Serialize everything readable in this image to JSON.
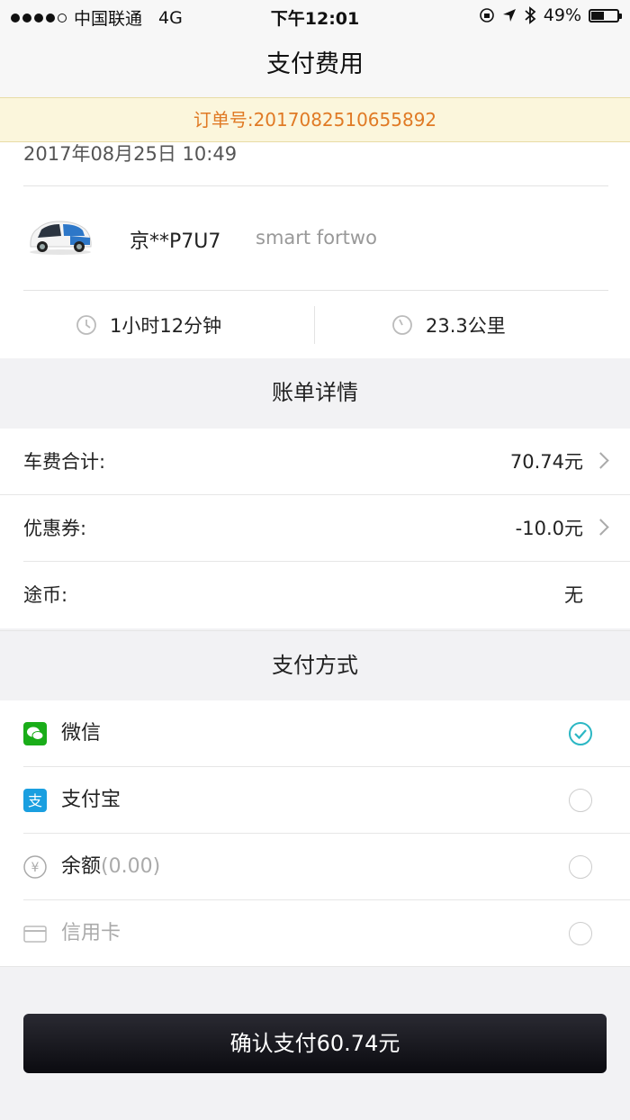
{
  "status_bar": {
    "carrier": "中国联通",
    "network": "4G",
    "time": "下午12:01",
    "battery": "49%",
    "battery_level": 0.49
  },
  "nav": {
    "title": "支付费用"
  },
  "order": {
    "label": "订单号:2017082510655892"
  },
  "trip": {
    "datetime": "2017年08月25日 10:49",
    "plate": "京**P7U7",
    "model": "smart fortwo",
    "duration": "1小时12分钟",
    "distance": "23.3公里"
  },
  "bill": {
    "header": "账单详情",
    "rows": [
      {
        "label": "车费合计:",
        "value": "70.74元"
      },
      {
        "label": "优惠券:",
        "value": "-10.0元"
      },
      {
        "label": "途币:",
        "value": "无"
      }
    ]
  },
  "payment": {
    "header": "支付方式",
    "methods": [
      {
        "label": "微信",
        "sub": "",
        "selected": true
      },
      {
        "label": "支付宝",
        "sub": "",
        "selected": false
      },
      {
        "label": "余额",
        "sub": "(0.00)",
        "selected": false
      },
      {
        "label": "信用卡",
        "sub": "",
        "selected": false
      }
    ]
  },
  "confirm": {
    "label": "确认支付60.74元"
  },
  "colors": {
    "order_text": "#e07a25",
    "order_bg": "#fbf6dc",
    "accent": "#2bb7c4",
    "wechat": "#1aad19",
    "alipay": "#1a9fe0"
  },
  "icons": {
    "duration": "clock-icon",
    "distance": "speedometer-icon",
    "wechat": "wechat-icon",
    "alipay": "alipay-icon",
    "balance": "yuan-icon",
    "card": "credit-card-icon"
  }
}
